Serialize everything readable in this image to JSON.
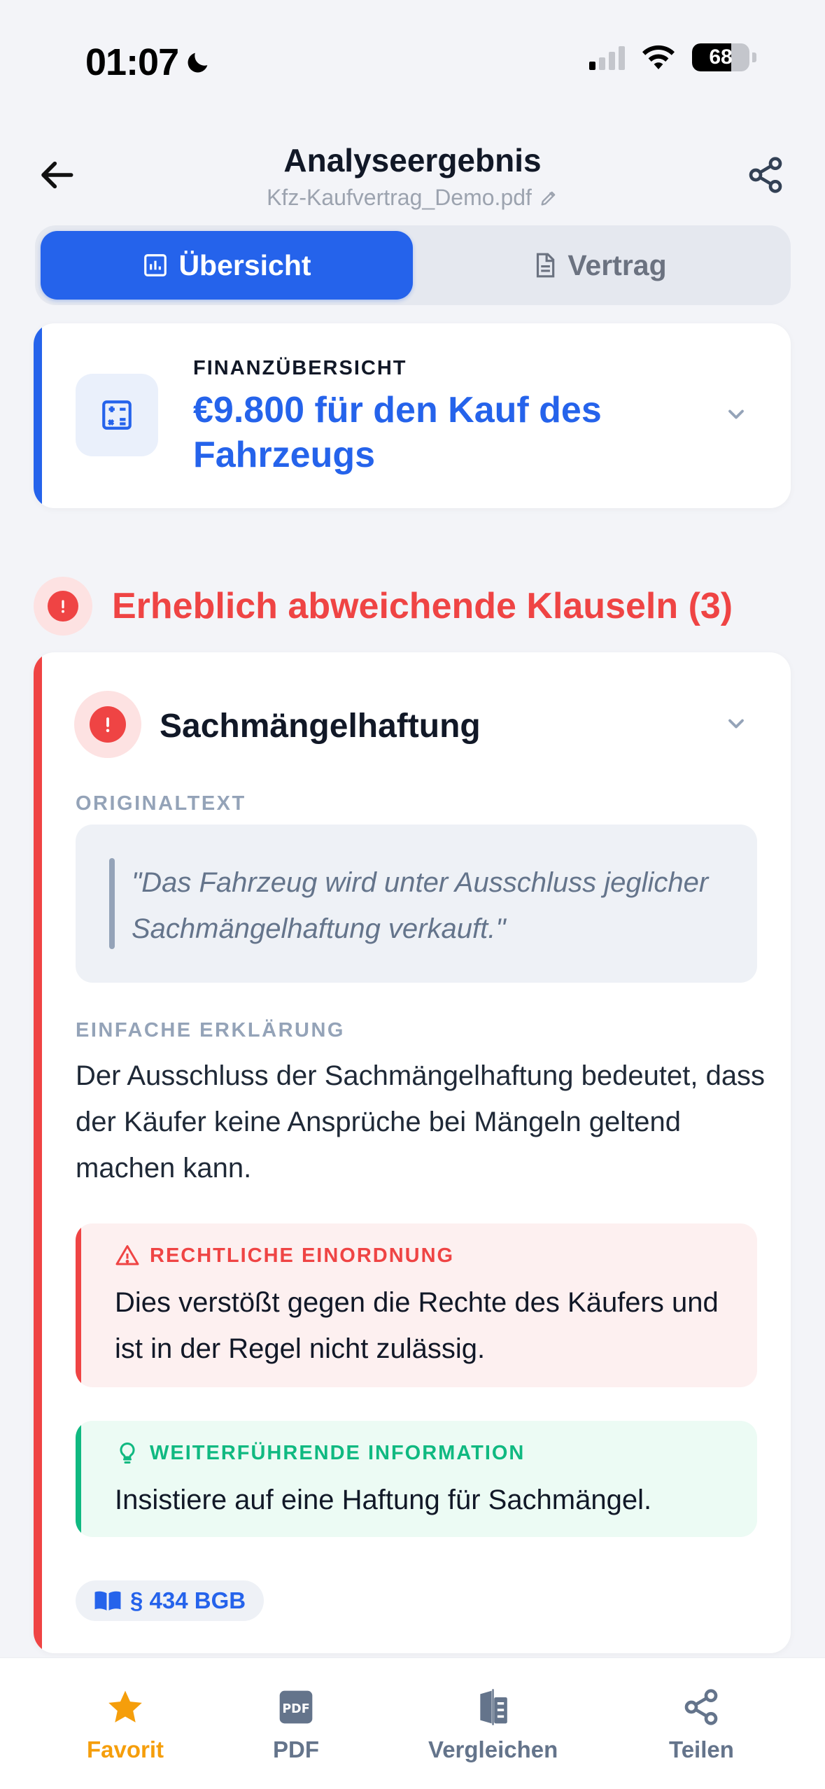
{
  "status_bar": {
    "time": "01:07",
    "battery": "68",
    "battery_level": 0.68
  },
  "header": {
    "title": "Analyseergebnis",
    "file_name": "Kfz-Kaufvertrag_Demo.pdf"
  },
  "tabs": [
    {
      "label": "Übersicht",
      "icon": "chart-icon",
      "active": true
    },
    {
      "label": "Vertrag",
      "icon": "document-icon",
      "active": false
    }
  ],
  "finance": {
    "label": "FINANZÜBERSICHT",
    "value": "€9.800 für den Kauf des Fahrzeugs",
    "icon": "calculator-icon"
  },
  "section": {
    "title": "Erheblich abweichende Klauseln (3)"
  },
  "clause": {
    "title": "Sachmängelhaftung",
    "original_label": "ORIGINALTEXT",
    "original_text": "\"Das Fahrzeug wird unter Ausschluss jeglicher Sachmängelhaftung verkauft.\"",
    "explanation_label": "EINFACHE ERKLÄRUNG",
    "explanation_text": "Der Ausschluss der Sachmängelhaftung bedeutet, dass der Käufer keine Ansprüche bei Mängeln geltend machen kann.",
    "legal_label": "RECHTLICHE EINORDNUNG",
    "legal_text": "Dies verstößt gegen die Rechte des Käufers und ist in der Regel nicht zulässig.",
    "info_label": "WEITERFÜHRENDE INFORMATION",
    "info_text": "Insistiere auf eine Haftung für Sachmängel.",
    "law_tag": "§ 434 BGB"
  },
  "bottom_tabs": [
    {
      "label": "Favorit",
      "icon": "star-icon"
    },
    {
      "label": "PDF",
      "icon": "pdf-icon"
    },
    {
      "label": "Vergleichen",
      "icon": "compare-icon"
    },
    {
      "label": "Teilen",
      "icon": "share-icon"
    }
  ],
  "colors": {
    "primary": "#2563eb",
    "danger": "#ef4444",
    "success": "#10b981",
    "favorite": "#f59e0b",
    "background": "#f3f4f8"
  }
}
